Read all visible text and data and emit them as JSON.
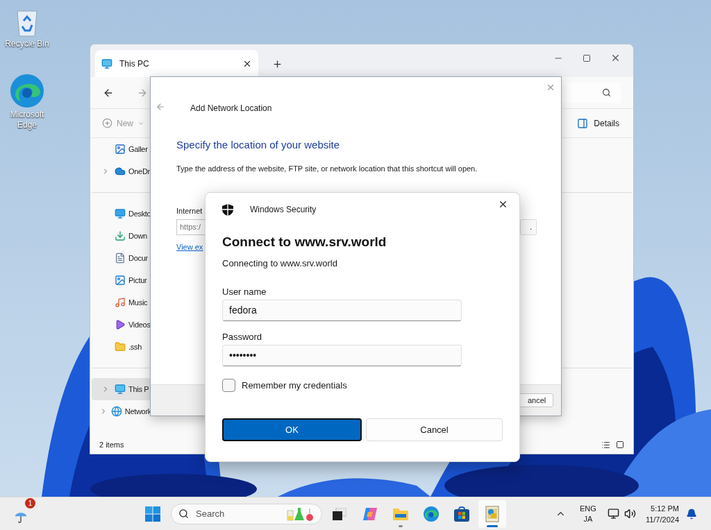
{
  "desktop_icons": [
    {
      "kind": "recycle-bin",
      "label": "Recycle Bin"
    },
    {
      "kind": "edge",
      "label": "Microsoft Edge"
    }
  ],
  "explorer": {
    "tabs": [
      {
        "label": "This PC",
        "selected": true
      }
    ],
    "new_button": {
      "label": "New",
      "disabled": true
    },
    "details_button": "Details",
    "sidebar": {
      "groups": [
        [
          {
            "kind": "gallery",
            "label": "Galler",
            "expandable": false,
            "selected": false
          },
          {
            "kind": "cloud",
            "label": "OneDr",
            "expandable": true,
            "selected": false
          }
        ],
        [
          {
            "kind": "desktop",
            "label": "Deskto",
            "expandable": false,
            "selected": false
          },
          {
            "kind": "download",
            "label": "Down",
            "expandable": false,
            "selected": false
          },
          {
            "kind": "document",
            "label": "Docur",
            "expandable": false,
            "selected": false
          },
          {
            "kind": "pictures",
            "label": "Pictur",
            "expandable": false,
            "selected": false
          },
          {
            "kind": "music",
            "label": "Music",
            "expandable": false,
            "selected": false
          },
          {
            "kind": "videos",
            "label": "Videos",
            "expandable": false,
            "selected": false
          },
          {
            "kind": "folder",
            "label": ".ssh",
            "expandable": false,
            "selected": false
          }
        ],
        [
          {
            "kind": "pc",
            "label": "This P",
            "expandable": true,
            "selected": true
          },
          {
            "kind": "network",
            "label": "Network",
            "expandable": true,
            "selected": false
          }
        ]
      ]
    },
    "status_bar": "2 items"
  },
  "add_network_location": {
    "title": "Add Network Location",
    "heading": "Specify the location of your website",
    "description": "Type the address of the website, FTP site, or network location that this shortcut will open.",
    "field_label": "Internet",
    "field_value": "https:/",
    "browse_button": ".",
    "link": "View ex",
    "cancel_button": "ancel"
  },
  "security_dialog": {
    "app": "Windows Security",
    "heading": "Connect to www.srv.world",
    "subheading": "Connecting to www.srv.world",
    "fields": [
      {
        "label": "User name",
        "value": "fedora"
      },
      {
        "label": "Password",
        "value": "••••••••"
      }
    ],
    "remember": {
      "label": "Remember my credentials",
      "checked": false
    },
    "buttons": [
      {
        "label": "OK",
        "primary": true
      },
      {
        "label": "Cancel",
        "primary": false
      }
    ]
  },
  "taskbar": {
    "weather_badge": "1",
    "search_placeholder": "Search",
    "apps": [
      {
        "kind": "start",
        "running": false,
        "active": false
      },
      {
        "kind": "task-view",
        "running": false,
        "active": false
      },
      {
        "kind": "copilot",
        "running": false,
        "active": false
      },
      {
        "kind": "file-explorer",
        "running": true,
        "active": false
      },
      {
        "kind": "edge",
        "running": false,
        "active": false
      },
      {
        "kind": "store",
        "running": false,
        "active": false
      },
      {
        "kind": "network-app",
        "running": true,
        "active": true
      }
    ],
    "language": [
      "ENG",
      "JA"
    ],
    "time": "5:12 PM",
    "date": "11/7/2024"
  }
}
